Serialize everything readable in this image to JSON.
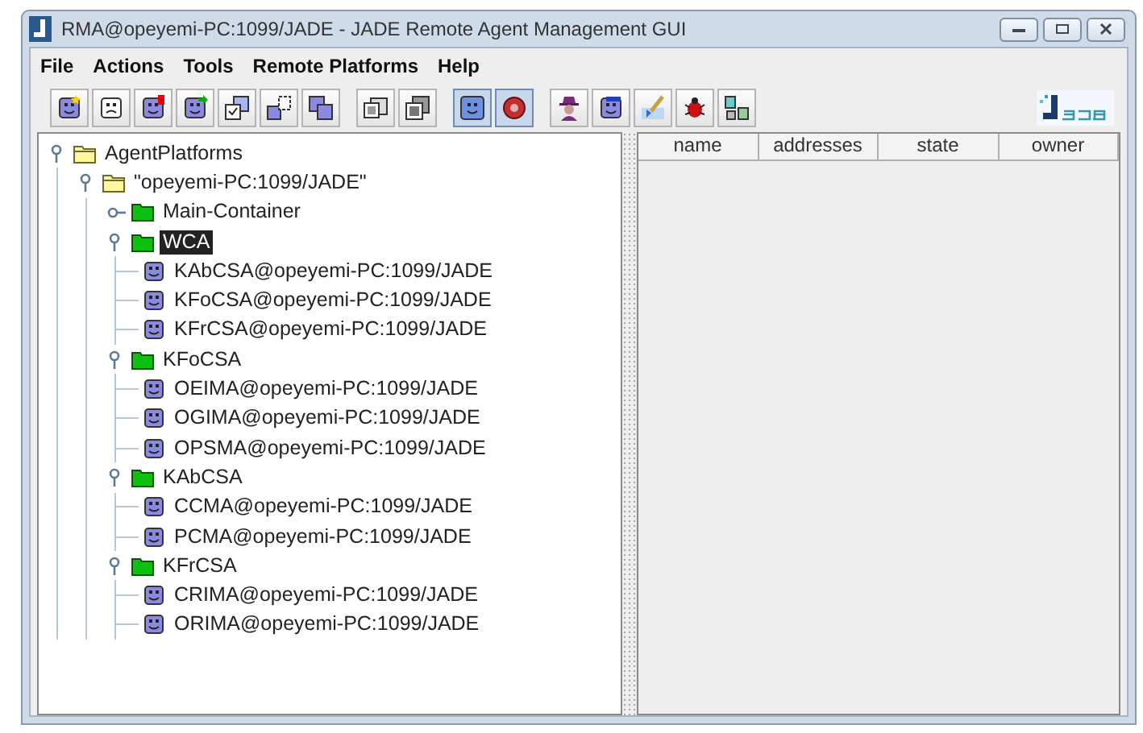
{
  "window": {
    "title": "RMA@opeyemi-PC:1099/JADE - JADE Remote Agent Management GUI"
  },
  "menu": [
    "File",
    "Actions",
    "Tools",
    "Remote Platforms",
    "Help"
  ],
  "toolbar": [
    [
      {
        "pressed": false
      },
      {
        "pressed": false
      },
      {
        "pressed": false
      },
      {
        "pressed": false
      },
      {
        "pressed": false
      },
      {
        "pressed": false
      },
      {
        "pressed": false
      }
    ],
    [
      {
        "pressed": false
      },
      {
        "pressed": false
      }
    ],
    [
      {
        "pressed": true
      },
      {
        "pressed": true
      }
    ],
    [
      {
        "pressed": false
      },
      {
        "pressed": false
      },
      {
        "pressed": false
      },
      {
        "pressed": false
      },
      {
        "pressed": false
      }
    ]
  ],
  "tree": [
    {
      "label": "AgentPlatforms",
      "kind": "folder",
      "expanded": true,
      "selected": false,
      "children": [
        {
          "label": "\"opeyemi-PC:1099/JADE\"",
          "kind": "folder",
          "expanded": true,
          "selected": false,
          "children": [
            {
              "label": "Main-Container",
              "kind": "container",
              "expanded": false,
              "selected": false
            },
            {
              "label": "WCA",
              "kind": "container",
              "expanded": true,
              "selected": true,
              "children": [
                {
                  "label": "KAbCSA@opeyemi-PC:1099/JADE",
                  "kind": "agent",
                  "selected": false
                },
                {
                  "label": "KFoCSA@opeyemi-PC:1099/JADE",
                  "kind": "agent",
                  "selected": false
                },
                {
                  "label": "KFrCSA@opeyemi-PC:1099/JADE",
                  "kind": "agent",
                  "selected": false
                }
              ]
            },
            {
              "label": "KFoCSA",
              "kind": "container",
              "expanded": true,
              "selected": false,
              "children": [
                {
                  "label": "OEIMA@opeyemi-PC:1099/JADE",
                  "kind": "agent",
                  "selected": false
                },
                {
                  "label": "OGIMA@opeyemi-PC:1099/JADE",
                  "kind": "agent",
                  "selected": false
                },
                {
                  "label": "OPSMA@opeyemi-PC:1099/JADE",
                  "kind": "agent",
                  "selected": false
                }
              ]
            },
            {
              "label": "KAbCSA",
              "kind": "container",
              "expanded": true,
              "selected": false,
              "children": [
                {
                  "label": "CCMA@opeyemi-PC:1099/JADE",
                  "kind": "agent",
                  "selected": false
                },
                {
                  "label": "PCMA@opeyemi-PC:1099/JADE",
                  "kind": "agent",
                  "selected": false
                }
              ]
            },
            {
              "label": "KFrCSA",
              "kind": "container",
              "expanded": true,
              "selected": false,
              "children": [
                {
                  "label": "CRIMA@opeyemi-PC:1099/JADE",
                  "kind": "agent",
                  "selected": false
                },
                {
                  "label": "ORIMA@opeyemi-PC:1099/JADE",
                  "kind": "agent",
                  "selected": false
                }
              ]
            }
          ]
        }
      ]
    }
  ],
  "table": {
    "columns": [
      "name",
      "addresses",
      "state",
      "owner"
    ]
  }
}
